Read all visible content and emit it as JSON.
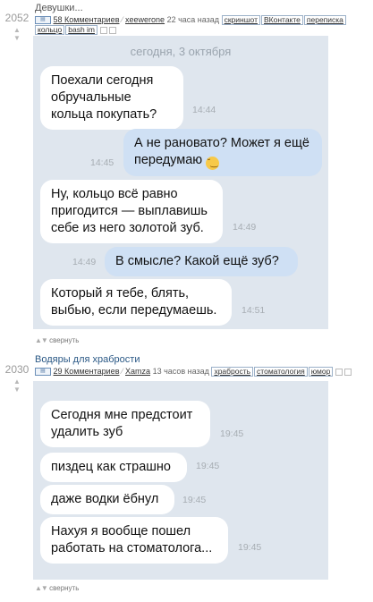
{
  "stories": [
    {
      "rating": "2052",
      "title": "Девушки...",
      "comments": "58 Комментариев",
      "author": "xeewerone",
      "time_ago": "22 часа назад",
      "tags": [
        "скриншот",
        "ВКонтакте",
        "переписка",
        "кольцо",
        "bash im"
      ],
      "date_separator": "сегодня, 3 октября",
      "messages": [
        {
          "side": "in",
          "text": "Поехали сегодня обручальные кольца покупать?",
          "time": "14:44"
        },
        {
          "side": "out",
          "text": "А не рановато? Может я ещё передумаю",
          "time": "14:45",
          "emoji": "smirk-emoji"
        },
        {
          "side": "in",
          "text": "Ну, кольцо всё равно пригодится — выплавишь себе из него золотой зуб.",
          "time": "14:49"
        },
        {
          "side": "out",
          "text": "В смысле? Какой ещё зуб?",
          "time": "14:49"
        },
        {
          "side": "in",
          "text": "Который я тебе, блять, выбью, если передумаешь.",
          "time": "14:51"
        }
      ],
      "collapse_label": "свернуть"
    },
    {
      "rating": "2030",
      "title": "Водяры для храбрости",
      "comments": "29 Комментариев",
      "author": "Xamza",
      "time_ago": "13 часов назад",
      "tags": [
        "храбрость",
        "стоматология",
        "юмор"
      ],
      "messages": [
        {
          "side": "in",
          "text": "Сегодня мне предстоит удалить зуб",
          "time": "19:45"
        },
        {
          "side": "in",
          "text": "пиздец как страшно",
          "time": "19:45"
        },
        {
          "side": "in",
          "text": "даже водки ёбнул",
          "time": "19:45"
        },
        {
          "side": "in",
          "text": "Нахуя я вообще пошел работать на стоматолога...",
          "time": "19:45"
        }
      ],
      "collapse_label": "свернуть"
    }
  ]
}
